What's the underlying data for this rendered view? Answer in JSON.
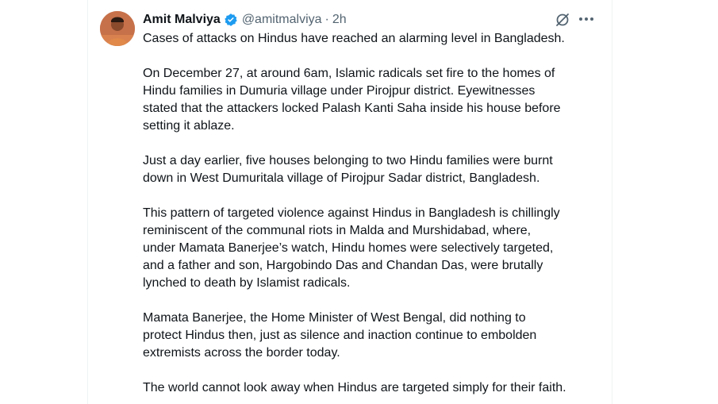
{
  "author": {
    "name": "Amit Malviya",
    "handle": "@amitmalviya",
    "separator": "·",
    "time": "2h",
    "verified_color": "#1d9bf0"
  },
  "icons": {
    "avatar": "profile-photo",
    "verified": "verified-badge-icon",
    "grok": "grok-icon",
    "more": "more-dots-icon"
  },
  "tweet": {
    "paragraphs": [
      "Cases of attacks on Hindus have reached an alarming level in Bangladesh.",
      "On December 27, at around 6am, Islamic radicals set fire to the homes of\nHindu families in Dumuria village under Pirojpur district. Eyewitnesses\nstated that the attackers locked Palash Kanti Saha inside his house before\nsetting it ablaze.",
      "Just a day earlier, five houses belonging to two Hindu families were burnt\ndown in West Dumuritala village of Pirojpur Sadar district, Bangladesh.",
      "This pattern of targeted violence against Hindus in Bangladesh is chillingly\nreminiscent of the communal riots in Malda and Murshidabad, where,\nunder Mamata Banerjee’s watch, Hindu homes were selectively targeted,\nand a father and son, Hargobindo Das and Chandan Das, were brutally\nlynched to death by Islamist radicals.",
      "Mamata Banerjee, the Home Minister of West Bengal, did nothing to\nprotect Hindus then, just as silence and inaction continue to embolden\nextremists across the border today.",
      "The world cannot look away when Hindus are targeted simply for their faith."
    ]
  }
}
